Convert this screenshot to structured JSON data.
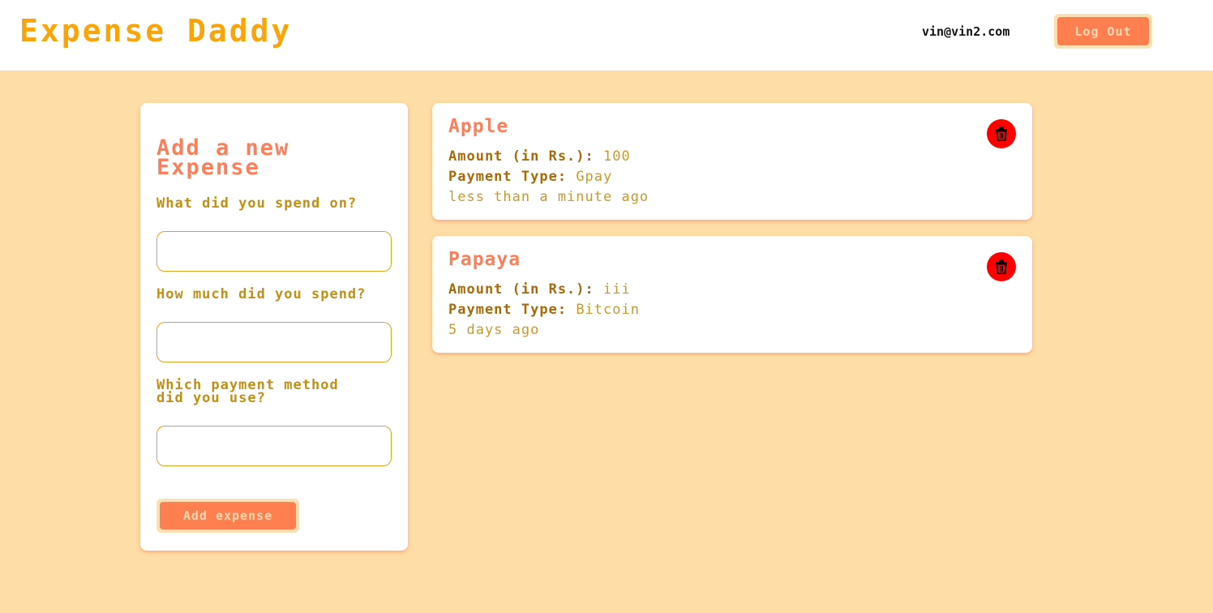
{
  "header": {
    "brand": "Expense Daddy",
    "user_email": "vin@vin2.com",
    "logout_label": "Log Out"
  },
  "form": {
    "title": "Add a new Expense",
    "fields": [
      {
        "label": "What did you spend on?",
        "value": ""
      },
      {
        "label": "How much did you spend?",
        "value": ""
      },
      {
        "label": "Which payment method did you use?",
        "value": ""
      }
    ],
    "submit_label": "Add expense"
  },
  "expenses": [
    {
      "name": "Apple",
      "amount_label": "Amount (in Rs.):",
      "amount": "100",
      "payment_label": "Payment Type:",
      "payment": "Gpay",
      "time": "less than a minute ago",
      "delete_icon": "trash-icon"
    },
    {
      "name": "Papaya",
      "amount_label": "Amount (in Rs.):",
      "amount": "iii",
      "payment_label": "Payment Type:",
      "payment": "Bitcoin",
      "time": "5 days ago",
      "delete_icon": "trash-icon"
    }
  ],
  "colors": {
    "page_background": "#fedda6",
    "brand": "#f9a50a",
    "accent": "#ff7f50",
    "label": "#c09014",
    "delete": "#ff0000"
  }
}
